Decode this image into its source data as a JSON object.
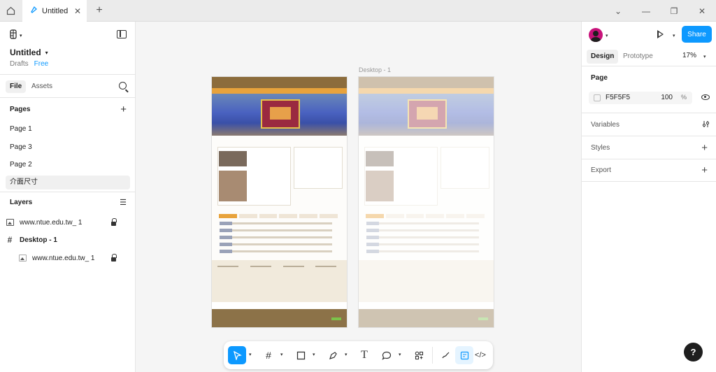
{
  "titlebar": {
    "tab_label": "Untitled",
    "home_icon": "home-icon",
    "window_controls": [
      "chevron-down-icon",
      "minimize-icon",
      "restore-icon",
      "close-icon"
    ]
  },
  "file": {
    "name": "Untitled",
    "location": "Drafts",
    "plan": "Free"
  },
  "left_tabs": {
    "file": "File",
    "assets": "Assets"
  },
  "pages": {
    "heading": "Pages",
    "items": [
      "Page 1",
      "Page 3",
      "Page 2",
      "介面尺寸"
    ],
    "active_index": 3
  },
  "layers": {
    "heading": "Layers",
    "items": [
      {
        "label": "www.ntue.edu.tw_ 1",
        "type": "image",
        "locked": true,
        "indent": 0
      },
      {
        "label": "Desktop - 1",
        "type": "frame",
        "locked": false,
        "indent": 0
      },
      {
        "label": "www.ntue.edu.tw_ 1",
        "type": "image",
        "locked": true,
        "indent": 1
      }
    ]
  },
  "canvas": {
    "frame_label": "Desktop - 1"
  },
  "toolbar": {
    "tools": [
      "move-icon",
      "frame-icon",
      "rectangle-icon",
      "pen-icon",
      "text-icon",
      "comment-icon",
      "actions-icon",
      "draw-mode-icon",
      "design-mode-icon",
      "dev-mode-icon"
    ]
  },
  "right": {
    "share_label": "Share",
    "tabs": {
      "design": "Design",
      "prototype": "Prototype"
    },
    "zoom": "17%",
    "page_section": "Page",
    "page_color": "F5F5F5",
    "page_opacity": "100",
    "percent_sign": "%",
    "variables": "Variables",
    "styles": "Styles",
    "export": "Export"
  },
  "help_label": "?",
  "colors": {
    "accent": "#0d99ff",
    "mock_header": "#8c6c3c",
    "mock_nav": "#e8a33c"
  }
}
